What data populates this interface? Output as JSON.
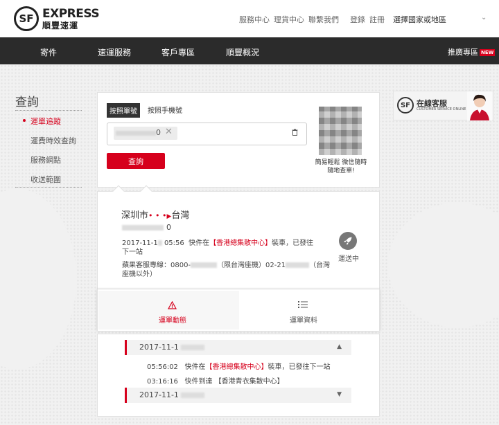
{
  "header": {
    "logo_en": "EXPRESS",
    "logo_zh": "順豐速運",
    "logo_mark": "SF",
    "links": [
      "服務中心",
      "理貨中心",
      "聯繫我們"
    ],
    "login": "登錄",
    "register": "註冊",
    "region": "選擇國家或地區"
  },
  "nav": {
    "items": [
      "寄件",
      "速運服務",
      "客戶專區",
      "順豐概況"
    ],
    "promo": "推廣專區",
    "promo_badge": "NEW"
  },
  "sidebar": {
    "title": "查詢",
    "items": [
      {
        "label": "運單追蹤"
      },
      {
        "label": "運費時效查詢"
      },
      {
        "label": "服務網點"
      },
      {
        "label": "收送範圍"
      }
    ]
  },
  "query": {
    "tab_active": "按照單號",
    "tab_other": "按照手機號",
    "chip_tail": "0",
    "chip_close": "✕",
    "trash_icon": "trash-icon",
    "button": "查詢",
    "qr_caption_1": "簡易輕鬆 微信隨時",
    "qr_caption_2": "隨地查單!"
  },
  "service": {
    "title": "在線客服",
    "subtitle": "CUSTOMER SERVICE ONLINE",
    "mark": "SF"
  },
  "shipment": {
    "origin": "深圳市",
    "dots": "• • •",
    "arrow": "▶",
    "destination": "台灣",
    "waybill_tail": "0",
    "status_time": "2017-11-1",
    "status_time_2": " 05:56",
    "status_pre": "快件在",
    "status_place": "【香港總集散中心】",
    "status_post": "裝車，已發往下一站",
    "phone_text_1": "蘋果客服專線：0800-",
    "phone_text_2": "（限台灣座機）02-21",
    "phone_text_3": "（台灣座機以外）",
    "transit_label": "運送中"
  },
  "detail_tabs": {
    "left": "運單動態",
    "right": "運單資料"
  },
  "timeline": {
    "date1": "2017-11-1",
    "date2": "2017-11-1",
    "events": [
      {
        "time": "05:56:02",
        "pre": "快件在",
        "place": "【香港總集散中心】",
        "post": "裝車，已發往下一站"
      },
      {
        "time": "03:16:16",
        "pre": "快件到達",
        "place": "【香港青衣集散中心】",
        "post": ""
      }
    ]
  },
  "colors": {
    "accent": "#d6001c",
    "nav_bg": "#2b2b2b"
  }
}
